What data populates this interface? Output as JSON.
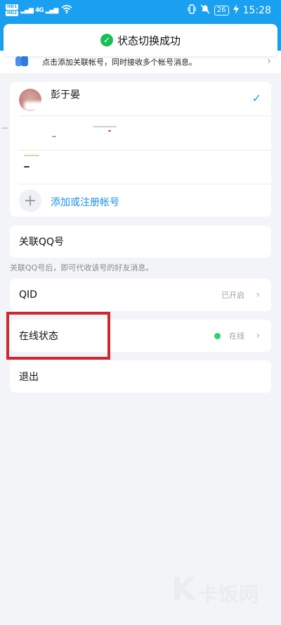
{
  "status_bar": {
    "hd1": "HD1",
    "hd2": "HD2",
    "signal": "4G",
    "battery": "26",
    "time": "15:28"
  },
  "toast": {
    "text": "状态切换成功"
  },
  "link_banner": {
    "text": "点击添加关联帐号，同时接收多个帐号消息。"
  },
  "accounts": {
    "current_name": "彭于晏",
    "add_label": "添加或注册帐号"
  },
  "linked_qq": {
    "label": "关联QQ号",
    "hint": "关联QQ号后，即可代收该号的好友消息。"
  },
  "qid": {
    "label": "QID",
    "value": "已开启"
  },
  "online_status": {
    "label": "在线状态",
    "value": "在线"
  },
  "logout": {
    "label": "退出"
  },
  "watermark": {
    "text": "卡饭网"
  },
  "colors": {
    "accent": "#1aa0f0",
    "online": "#2bd36b",
    "highlight": "#d0262e",
    "success": "#1bbd55"
  }
}
